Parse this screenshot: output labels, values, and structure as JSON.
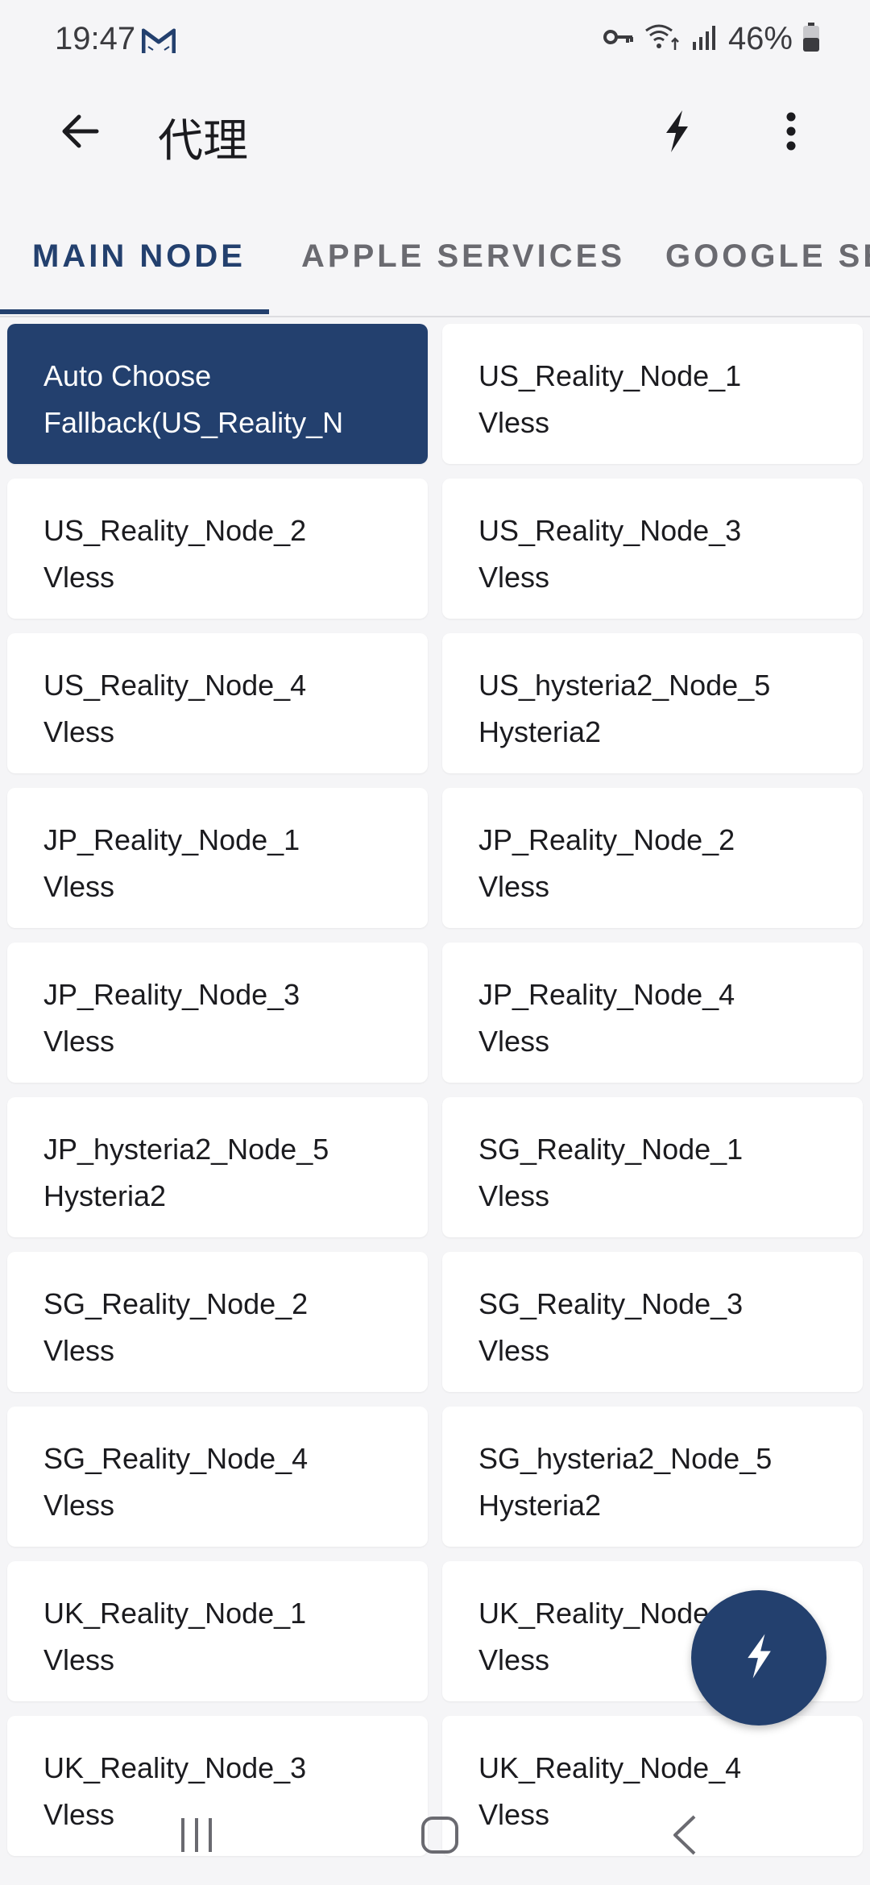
{
  "status_bar": {
    "time": "19:47",
    "battery": "46%",
    "icons": [
      "gmail-icon",
      "vpn-key-icon",
      "wifi-icon",
      "signal-icon",
      "battery-icon"
    ]
  },
  "app_bar": {
    "title": "代理",
    "icons": [
      "back-arrow-icon",
      "bolt-icon",
      "more-vert-icon"
    ]
  },
  "tabs": [
    {
      "label": "MAIN NODE",
      "active": true
    },
    {
      "label": "APPLE SERVICES",
      "active": false
    },
    {
      "label": "GOOGLE SE",
      "active": false
    }
  ],
  "nodes": [
    {
      "name": "Auto Choose",
      "type": "Fallback(US_Reality_N",
      "selected": true
    },
    {
      "name": "US_Reality_Node_1",
      "type": "Vless"
    },
    {
      "name": "US_Reality_Node_2",
      "type": "Vless"
    },
    {
      "name": "US_Reality_Node_3",
      "type": "Vless"
    },
    {
      "name": "US_Reality_Node_4",
      "type": "Vless"
    },
    {
      "name": "US_hysteria2_Node_5",
      "type": "Hysteria2"
    },
    {
      "name": "JP_Reality_Node_1",
      "type": "Vless"
    },
    {
      "name": "JP_Reality_Node_2",
      "type": "Vless"
    },
    {
      "name": "JP_Reality_Node_3",
      "type": "Vless"
    },
    {
      "name": "JP_Reality_Node_4",
      "type": "Vless"
    },
    {
      "name": "JP_hysteria2_Node_5",
      "type": "Hysteria2"
    },
    {
      "name": "SG_Reality_Node_1",
      "type": "Vless"
    },
    {
      "name": "SG_Reality_Node_2",
      "type": "Vless"
    },
    {
      "name": "SG_Reality_Node_3",
      "type": "Vless"
    },
    {
      "name": "SG_Reality_Node_4",
      "type": "Vless"
    },
    {
      "name": "SG_hysteria2_Node_5",
      "type": "Hysteria2"
    },
    {
      "name": "UK_Reality_Node_1",
      "type": "Vless"
    },
    {
      "name": "UK_Reality_Node_2",
      "type": "Vless"
    },
    {
      "name": "UK_Reality_Node_3",
      "type": "Vless"
    },
    {
      "name": "UK_Reality_Node_4",
      "type": "Vless"
    }
  ],
  "fab": {
    "icon": "bolt-icon"
  },
  "nav_bar": {
    "icons": [
      "recent-apps-icon",
      "home-icon",
      "back-icon"
    ]
  },
  "colors": {
    "accent": "#23406e",
    "background": "#f5f5f7",
    "card": "#ffffff"
  }
}
